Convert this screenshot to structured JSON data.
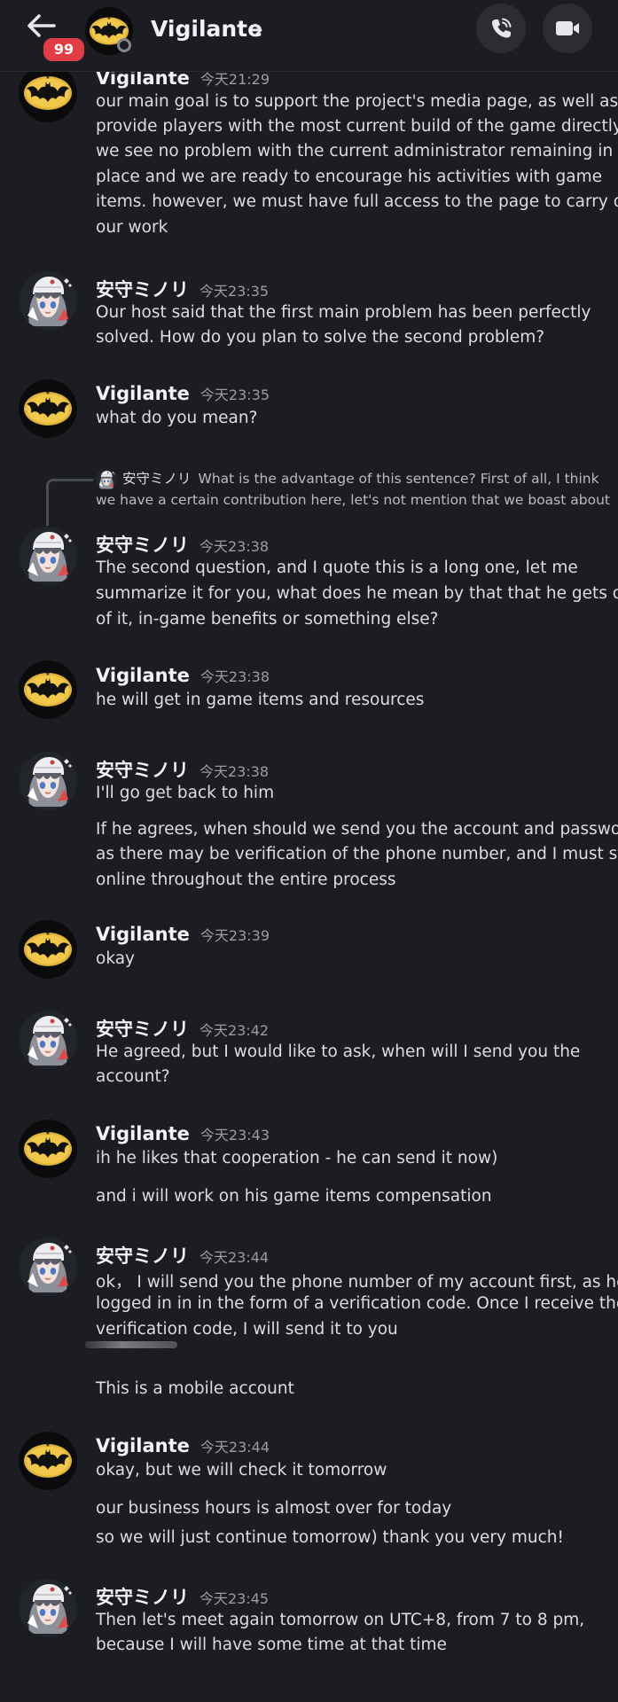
{
  "header": {
    "title": "Vigilante",
    "unread_badge": "99",
    "icons": {
      "back": "arrow-left-icon",
      "chevron": "chevron-right-icon",
      "call": "phone-call-icon",
      "video": "video-camera-icon"
    }
  },
  "users": {
    "vigilante": {
      "name": "Vigilante",
      "avatar": "bat-logo-avatar"
    },
    "minori": {
      "name": "安守ミノリ",
      "avatar": "anime-girl-avatar"
    }
  },
  "reply_preview": {
    "author": "安守ミノリ",
    "text_line1": "What is the advantage of this sentence? First of all, I think",
    "text_line2": "we have a certain contribution here, let's not mention that we boast about"
  },
  "messages": [
    {
      "author": "Vigilante",
      "time": "今天21:29",
      "lines": [
        "our main goal is to support the project's media page, as well as",
        "provide players with the most current build of the game directly.",
        "we see no problem with the current administrator remaining in his",
        "place and we are ready to encourage his activities with game",
        "items. however, we must have full access to the page to carry out",
        "our work"
      ]
    },
    {
      "author": "安守ミノリ",
      "time": "今天23:35",
      "lines": [
        "Our host said that the first main problem has been perfectly",
        "solved. How do you plan to solve the second problem?"
      ]
    },
    {
      "author": "Vigilante",
      "time": "今天23:35",
      "lines": [
        "what do you mean?"
      ]
    },
    {
      "author": "安守ミノリ",
      "time": "今天23:38",
      "lines": [
        "The second question, and I quote this is a long one, let me",
        "summarize it for you, what does he mean by that that he gets out",
        "of it, in-game benefits or something else?"
      ]
    },
    {
      "author": "Vigilante",
      "time": "今天23:38",
      "lines": [
        "he will get in game items and resources"
      ]
    },
    {
      "author": "安守ミノリ",
      "time": "今天23:38",
      "lines": [
        "I'll go get back to him",
        "If he agrees, when should we send you the account and password,",
        "as there may be verification of the phone number, and I must stay",
        "online throughout the entire process"
      ]
    },
    {
      "author": "Vigilante",
      "time": "今天23:39",
      "lines": [
        "okay"
      ]
    },
    {
      "author": "安守ミノリ",
      "time": "今天23:42",
      "lines": [
        "He agreed, but I would like to ask, when will I send you the",
        "account?"
      ]
    },
    {
      "author": "Vigilante",
      "time": "今天23:43",
      "lines": [
        "ih he likes that cooperation - he can send it now)",
        "and i will work on his game items compensation"
      ]
    },
    {
      "author": "安守ミノリ",
      "time": "今天23:44",
      "lines": [
        "ok，  I will send you the phone number of my account first, as he",
        "logged in in in the form of a verification code. Once I receive the",
        "verification code, I will send it to you",
        "This is a mobile account"
      ]
    },
    {
      "author": "Vigilante",
      "time": "今天23:44",
      "lines": [
        "okay, but we will check it tomorrow",
        "our business hours is almost over for today",
        "so we will just continue tomorrow) thank you very much!"
      ]
    },
    {
      "author": "安守ミノリ",
      "time": "今天23:45",
      "lines": [
        "Then let's meet again tomorrow on UTC+8, from 7 to 8 pm,",
        "because I will have some time at that time"
      ]
    }
  ]
}
